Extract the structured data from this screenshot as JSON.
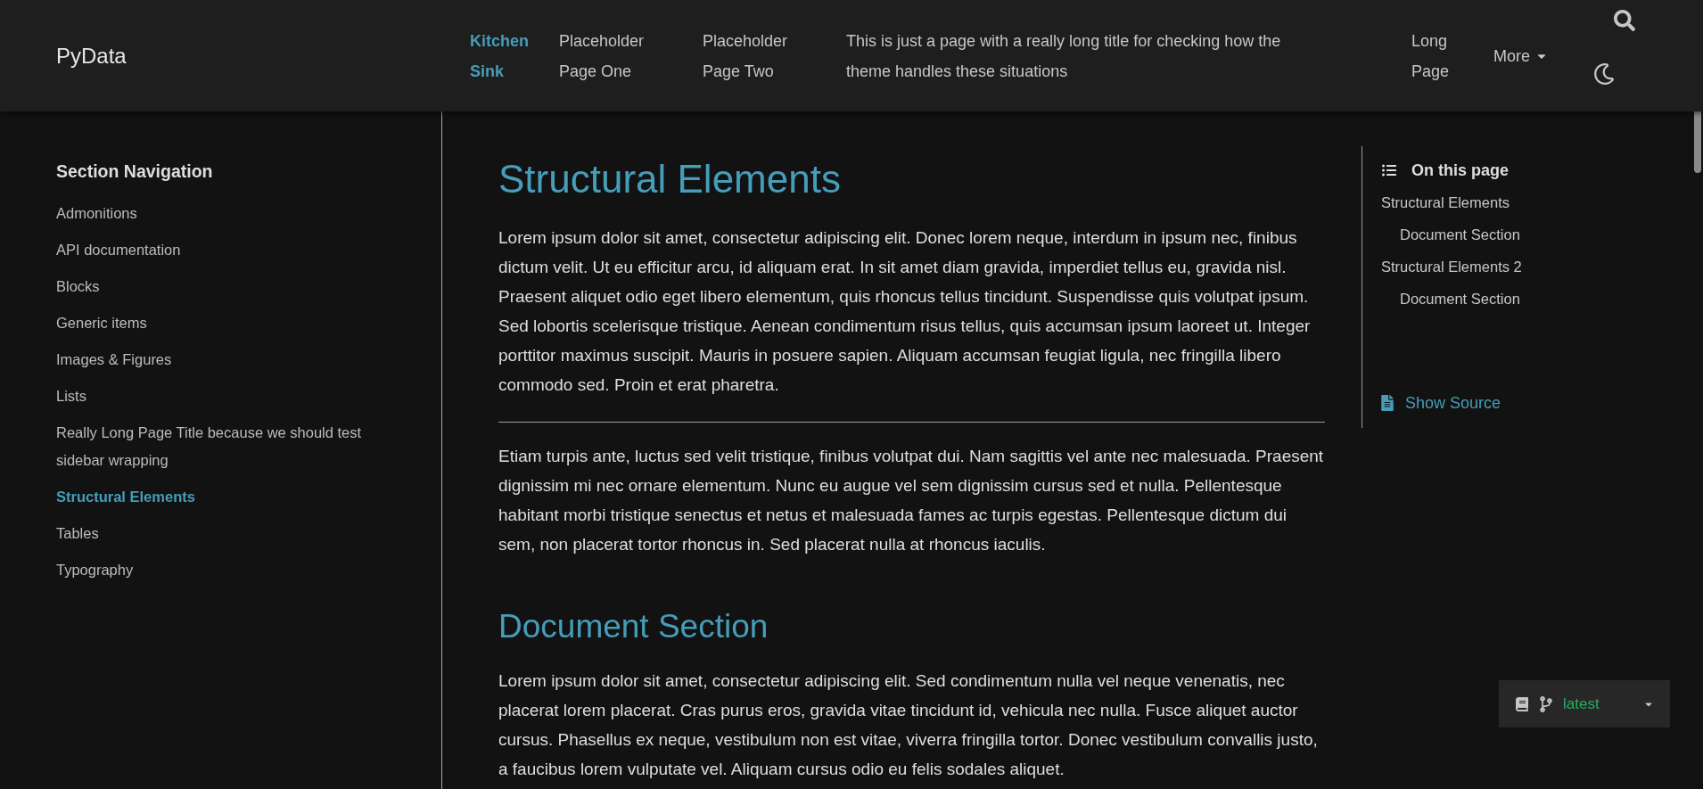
{
  "header": {
    "logo": "PyData",
    "nav": [
      {
        "label": "Kitchen Sink",
        "selected": true
      },
      {
        "label": "Placeholder Page One",
        "selected": false
      },
      {
        "label": "Placeholder Page Two",
        "selected": false
      },
      {
        "label": "This is just a page with a really long title for checking how the theme handles these situations",
        "selected": false
      },
      {
        "label": "Long Page",
        "selected": false
      }
    ],
    "more": "More"
  },
  "sidebar": {
    "title": "Section Navigation",
    "items": [
      {
        "label": "Admonitions",
        "selected": false
      },
      {
        "label": "API documentation",
        "selected": false
      },
      {
        "label": "Blocks",
        "selected": false
      },
      {
        "label": "Generic items",
        "selected": false
      },
      {
        "label": "Images & Figures",
        "selected": false
      },
      {
        "label": "Lists",
        "selected": false
      },
      {
        "label": "Really Long Page Title because we should test sidebar wrapping",
        "selected": false
      },
      {
        "label": "Structural Elements",
        "selected": true
      },
      {
        "label": "Tables",
        "selected": false
      },
      {
        "label": "Typography",
        "selected": false
      }
    ]
  },
  "article": [
    {
      "kind": "h1",
      "text": "Structural Elements"
    },
    {
      "kind": "p",
      "text": "Lorem ipsum dolor sit amet, consectetur adipiscing elit. Donec lorem neque, interdum in ipsum nec, finibus dictum velit. Ut eu efficitur arcu, id aliquam erat. In sit amet diam gravida, imperdiet tellus eu, gravida nisl. Praesent aliquet odio eget libero elementum, quis rhoncus tellus tincidunt. Suspendisse quis volutpat ipsum. Sed lobortis scelerisque tristique. Aenean condimentum risus tellus, quis accumsan ipsum laoreet ut. Integer porttitor maximus suscipit. Mauris in posuere sapien. Aliquam accumsan feugiat ligula, nec fringilla libero commodo sed. Proin et erat pharetra."
    },
    {
      "kind": "hr"
    },
    {
      "kind": "p",
      "text": "Etiam turpis ante, luctus sed velit tristique, finibus volutpat dui. Nam sagittis vel ante nec malesuada. Praesent dignissim mi nec ornare elementum. Nunc eu augue vel sem dignissim cursus sed et nulla. Pellentesque habitant morbi tristique senectus et netus et malesuada fames ac turpis egestas. Pellentesque dictum dui sem, non placerat tortor rhoncus in. Sed placerat nulla at rhoncus iaculis."
    },
    {
      "kind": "h2",
      "text": "Document Section"
    },
    {
      "kind": "p",
      "text": "Lorem ipsum dolor sit amet, consectetur adipiscing elit. Sed condimentum nulla vel neque venenatis, nec placerat lorem placerat. Cras purus eros, gravida vitae tincidunt id, vehicula nec nulla. Fusce aliquet auctor cursus. Phasellus ex neque, vestibulum non est vitae, viverra fringilla tortor. Donec vestibulum convallis justo, a faucibus lorem vulputate vel. Aliquam cursus odio eu felis sodales aliquet."
    }
  ],
  "toc": {
    "title": "On this page",
    "items": [
      {
        "label": "Structural Elements",
        "children": [
          {
            "label": "Document Section"
          }
        ]
      },
      {
        "label": "Structural Elements 2",
        "children": [
          {
            "label": "Document Section"
          }
        ]
      }
    ],
    "show_source": "Show Source"
  },
  "version_menu": {
    "label": "latest"
  }
}
